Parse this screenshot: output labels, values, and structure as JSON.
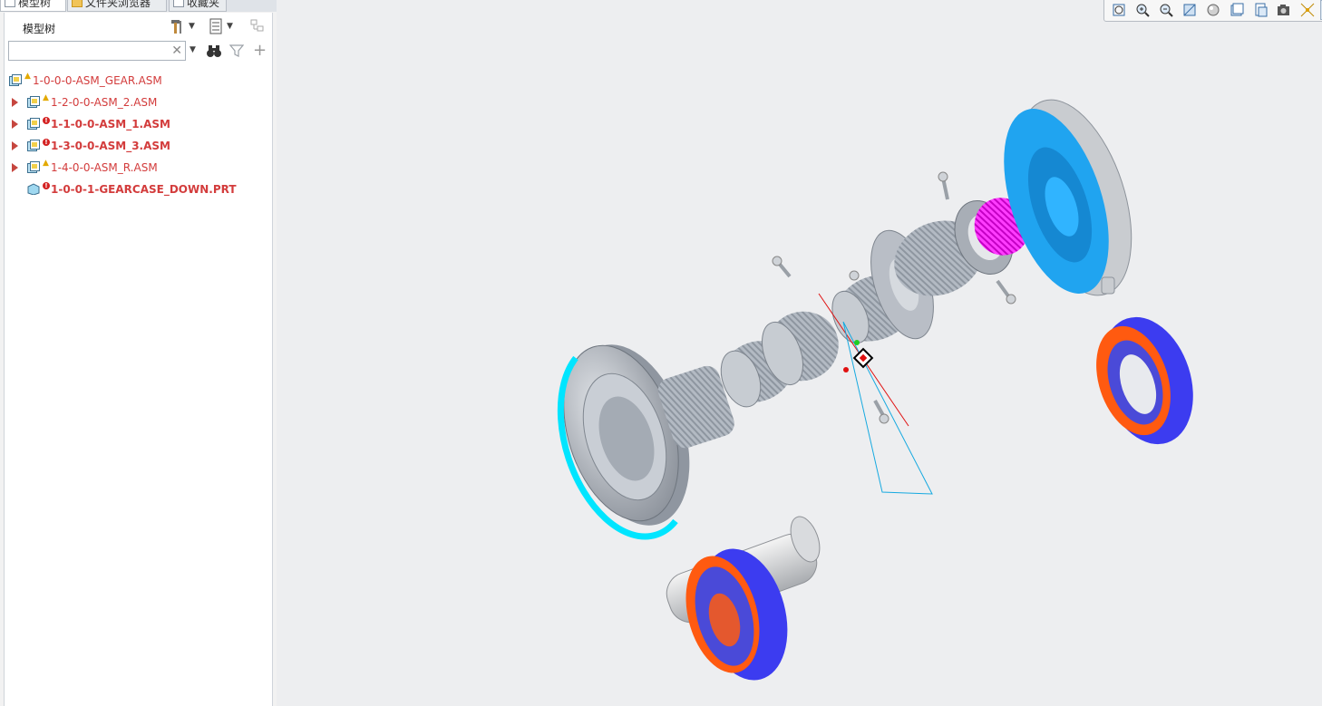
{
  "panel_tabs": [
    {
      "label": "模型树",
      "active": true
    },
    {
      "label": "文件夹浏览器",
      "active": false
    },
    {
      "label": "收藏夹",
      "active": false
    }
  ],
  "tree_panel": {
    "title": "模型树",
    "toolbar_icons": [
      "settings-hammer-icon",
      "show-list-icon",
      "filter-tree-icon"
    ],
    "search": {
      "value": "",
      "placeholder": ""
    },
    "search_icons": [
      "find-binoculars-icon",
      "filter-icon",
      "add-icon"
    ]
  },
  "tree": [
    {
      "label": "1-0-0-0-ASM_GEAR.ASM",
      "status": "warning",
      "expander": false,
      "bold": false,
      "type": "assembly",
      "level": 0
    },
    {
      "label": "1-2-0-0-ASM_2.ASM",
      "status": "warning",
      "expander": true,
      "bold": false,
      "type": "assembly",
      "level": 1
    },
    {
      "label": "1-1-0-0-ASM_1.ASM",
      "status": "error",
      "expander": true,
      "bold": true,
      "type": "assembly",
      "level": 1
    },
    {
      "label": "1-3-0-0-ASM_3.ASM",
      "status": "error",
      "expander": true,
      "bold": true,
      "type": "assembly",
      "level": 1
    },
    {
      "label": "1-4-0-0-ASM_R.ASM",
      "status": "warning",
      "expander": true,
      "bold": false,
      "type": "assembly",
      "level": 1
    },
    {
      "label": "1-0-0-1-GEARCASE_DOWN.PRT",
      "status": "error",
      "expander": false,
      "bold": true,
      "type": "part",
      "level": 1
    }
  ],
  "view_toolbar": [
    {
      "name": "refit-icon",
      "active": false
    },
    {
      "name": "zoom-in-icon",
      "active": false
    },
    {
      "name": "zoom-out-icon",
      "active": false
    },
    {
      "name": "repaint-icon",
      "active": false
    },
    {
      "name": "display-style-icon",
      "active": false
    },
    {
      "name": "saved-orientations-icon",
      "active": false
    },
    {
      "name": "view-manager-icon",
      "active": false
    },
    {
      "name": "perspective-icon",
      "active": false
    },
    {
      "name": "datum-display-icon",
      "active": false
    },
    {
      "name": "spin-center-icon",
      "active": true
    },
    {
      "name": "annotation-display-icon",
      "active": true
    }
  ],
  "colors": {
    "tree_text": "#d33c3c",
    "highlight_cyan": "#00e5ff",
    "highlight_magenta": "#ff00ff",
    "highlight_blue": "#20a4f0",
    "highlight_orange": "#ff5a10",
    "highlight_violet": "#3c3cf0",
    "part_gray": "#b9bec7"
  }
}
